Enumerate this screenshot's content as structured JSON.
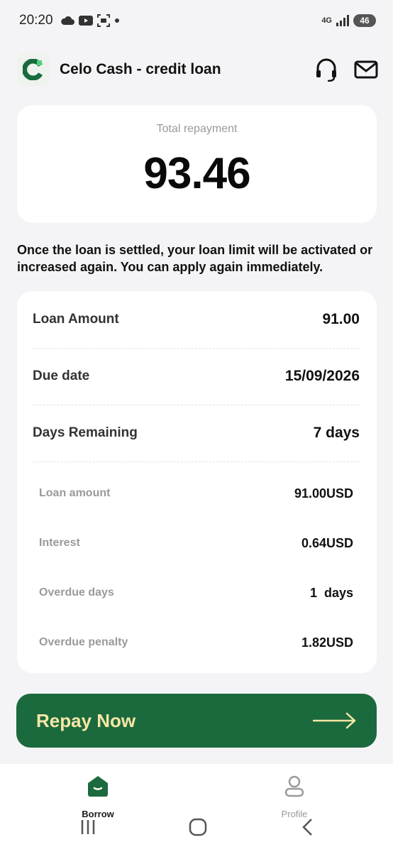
{
  "status_bar": {
    "time": "20:20",
    "network": "4G",
    "battery": "46"
  },
  "header": {
    "app_name": "Celo Cash - credit loan",
    "logo_letter": "C"
  },
  "total": {
    "label": "Total repayment",
    "amount": "93.46"
  },
  "notice": "Once the loan is settled, your loan limit will be activated or increased again. You can apply again immediately.",
  "details": {
    "main_rows": [
      {
        "label": "Loan Amount",
        "value": "91.00"
      },
      {
        "label": "Due date",
        "value": "15/09/2026"
      },
      {
        "label": "Days Remaining",
        "value": "7 days"
      }
    ],
    "sub_rows": [
      {
        "label": "Loan amount",
        "value": "91.00USD"
      },
      {
        "label": "Interest",
        "value": "0.64USD"
      },
      {
        "label": "Overdue days",
        "value": "1  days"
      },
      {
        "label": "Overdue penalty",
        "value": "1.82USD"
      }
    ]
  },
  "repay_button": {
    "label": "Repay Now"
  },
  "bottom_nav": {
    "items": [
      {
        "label": "Borrow",
        "icon": "home-icon",
        "active": true
      },
      {
        "label": "Profile",
        "icon": "user-icon",
        "active": false
      }
    ]
  },
  "colors": {
    "brand_green": "#1b6a3d",
    "button_text": "#f6e6a6",
    "background": "#f4f4f6"
  }
}
